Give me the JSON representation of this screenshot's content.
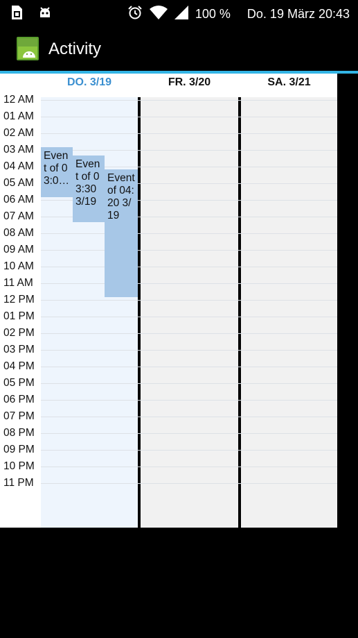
{
  "status_bar": {
    "icons": [
      "sim-card-icon",
      "android-debug-icon",
      "alarm-icon",
      "wifi-icon",
      "cell-signal-icon"
    ],
    "battery": "100 %",
    "datetime": "Do. 19 März 20:43"
  },
  "action_bar": {
    "title": "Activity",
    "icon": "android-app-icon"
  },
  "colors": {
    "accent": "#33b5e5",
    "today_header": "#3a8fd0",
    "today_column": "#eef5fd",
    "event": "#a7c7e7"
  },
  "calendar": {
    "days": [
      {
        "label": "DO. 3/19",
        "is_today": true
      },
      {
        "label": "FR. 3/20",
        "is_today": false
      },
      {
        "label": "SA. 3/21",
        "is_today": false
      }
    ],
    "hours": [
      "12 AM",
      "01 AM",
      "02 AM",
      "03 AM",
      "04 AM",
      "05 AM",
      "06 AM",
      "07 AM",
      "08 AM",
      "09 AM",
      "10 AM",
      "11 AM",
      "12 PM",
      "01 PM",
      "02 PM",
      "03 PM",
      "04 PM",
      "05 PM",
      "06 PM",
      "07 PM",
      "08 PM",
      "09 PM",
      "10 PM",
      "11 PM"
    ],
    "events": [
      {
        "text": "Event of 03:0…"
      },
      {
        "text": "Event of 03:30 3/19"
      },
      {
        "text": "Event of 04:20 3/19"
      }
    ]
  }
}
